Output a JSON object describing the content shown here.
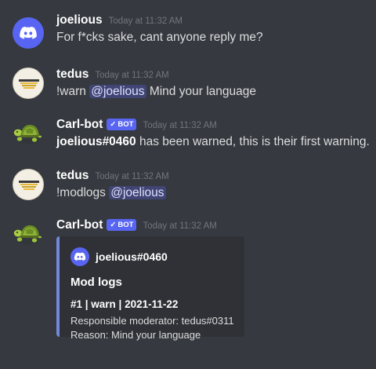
{
  "messages": [
    {
      "author": "joelious",
      "timestamp": "Today at 11:32 AM",
      "avatar_icon": "discord-logo-icon",
      "text": "For f*cks sake, cant anyone reply me?"
    },
    {
      "author": "tedus",
      "timestamp": "Today at 11:32 AM",
      "avatar_icon": "tedus-avatar",
      "command": "!warn",
      "mention": "@joelious",
      "text": "Mind your language"
    },
    {
      "author": "Carl-bot",
      "bot_tag": "BOT",
      "timestamp": "Today at 11:32 AM",
      "avatar_icon": "turtle-icon",
      "bold_user": "joelious#0460",
      "text": "has been warned, this is their first warning."
    },
    {
      "author": "tedus",
      "timestamp": "Today at 11:32 AM",
      "avatar_icon": "tedus-avatar",
      "command": "!modlogs",
      "mention": "@joelious"
    },
    {
      "author": "Carl-bot",
      "bot_tag": "BOT",
      "timestamp": "Today at 11:32 AM",
      "avatar_icon": "turtle-icon",
      "embed": {
        "author_name": "joelious#0460",
        "title": "Mod logs",
        "field_name": "#1 | warn | 2021-11-22",
        "line1": "Responsible moderator: tedus#0311",
        "line2": "Reason: Mind your language",
        "accent_color": "#7289da"
      }
    }
  ],
  "colors": {
    "background": "#36393f",
    "bot_tag": "#5865f2",
    "mention_bg": "rgba(88,101,242,0.3)",
    "embed_bg": "#2f3136"
  }
}
